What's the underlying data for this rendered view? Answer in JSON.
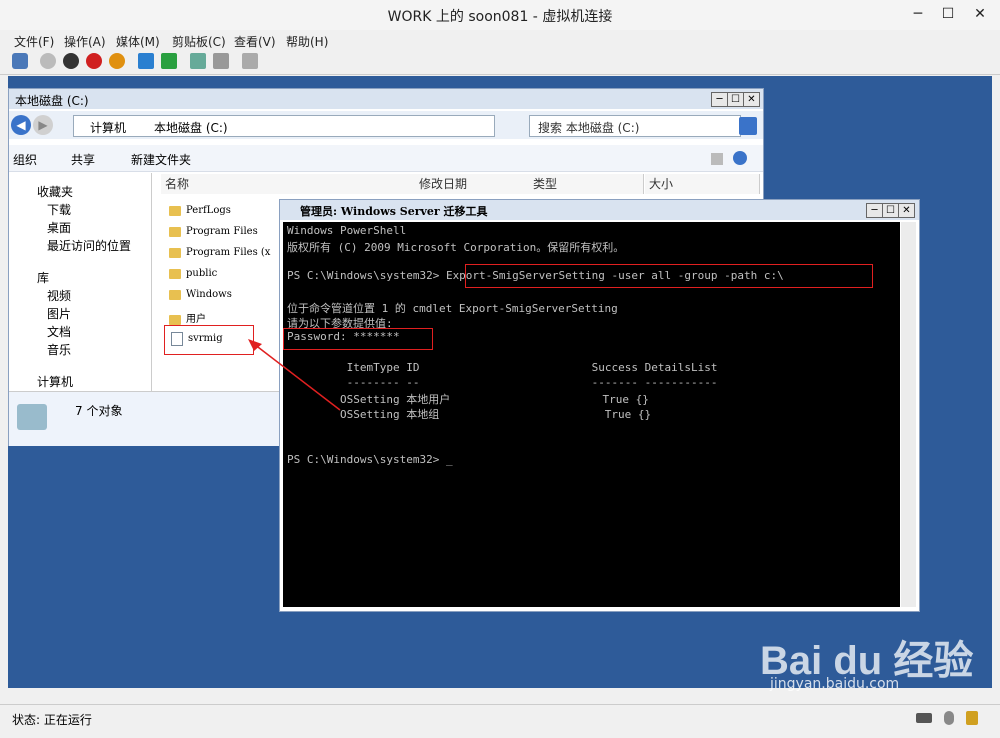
{
  "app": {
    "title": "WORK 上的 soon081 - 虚拟机连接",
    "min": "─",
    "max": "☐",
    "close": "✕"
  },
  "menu": [
    "文件(F)",
    "操作(A)",
    "媒体(M)",
    "剪贴板(C)",
    "查看(V)",
    "帮助(H)"
  ],
  "explorer": {
    "title": "本地磁盘 (C:)",
    "breadcrumb": [
      "计算机",
      "本地磁盘 (C:)"
    ],
    "search_placeholder": "搜索 本地磁盘 (C:)",
    "commands": [
      "组织",
      "共享",
      "新建文件夹"
    ],
    "columns": [
      "名称",
      "修改日期",
      "类型",
      "大小"
    ],
    "favorites_label": "收藏夹",
    "favorites": [
      "下载",
      "桌面",
      "最近访问的位置"
    ],
    "libraries_label": "库",
    "libraries": [
      "视频",
      "图片",
      "文档",
      "音乐"
    ],
    "computer_label": "计算机",
    "files": [
      "PerfLogs",
      "Program Files",
      "Program Files (x",
      "public",
      "Windows",
      "用户",
      "svrmig"
    ],
    "status_count": "7 个对象"
  },
  "powershell": {
    "title": "管理员: Windows Server 迁移工具",
    "lines": [
      "Windows PowerShell",
      "版权所有 (C) 2009 Microsoft Corporation。保留所有权利。",
      "",
      "PS C:\\Windows\\system32> Export-SmigServerSetting -user all -group -path c:\\",
      "",
      "位于命令管道位置 1 的 cmdlet Export-SmigServerSetting",
      "请为以下参数提供值:",
      "Password: *******",
      "",
      "         ItemType ID                          Success DetailsList",
      "         -------- --                          ------- -----------",
      "        OSSetting 本地用户                       True {}",
      "        OSSetting 本地组                         True {}",
      "",
      "",
      "PS C:\\Windows\\system32> _"
    ]
  },
  "status": {
    "label": "状态: 正在运行"
  },
  "watermark": {
    "brand": "Bai du 经验",
    "url": "jingyan.baidu.com"
  },
  "colors": {
    "desktop": "#2e5b99",
    "console_bg": "#000000",
    "highlight": "#e02020"
  }
}
